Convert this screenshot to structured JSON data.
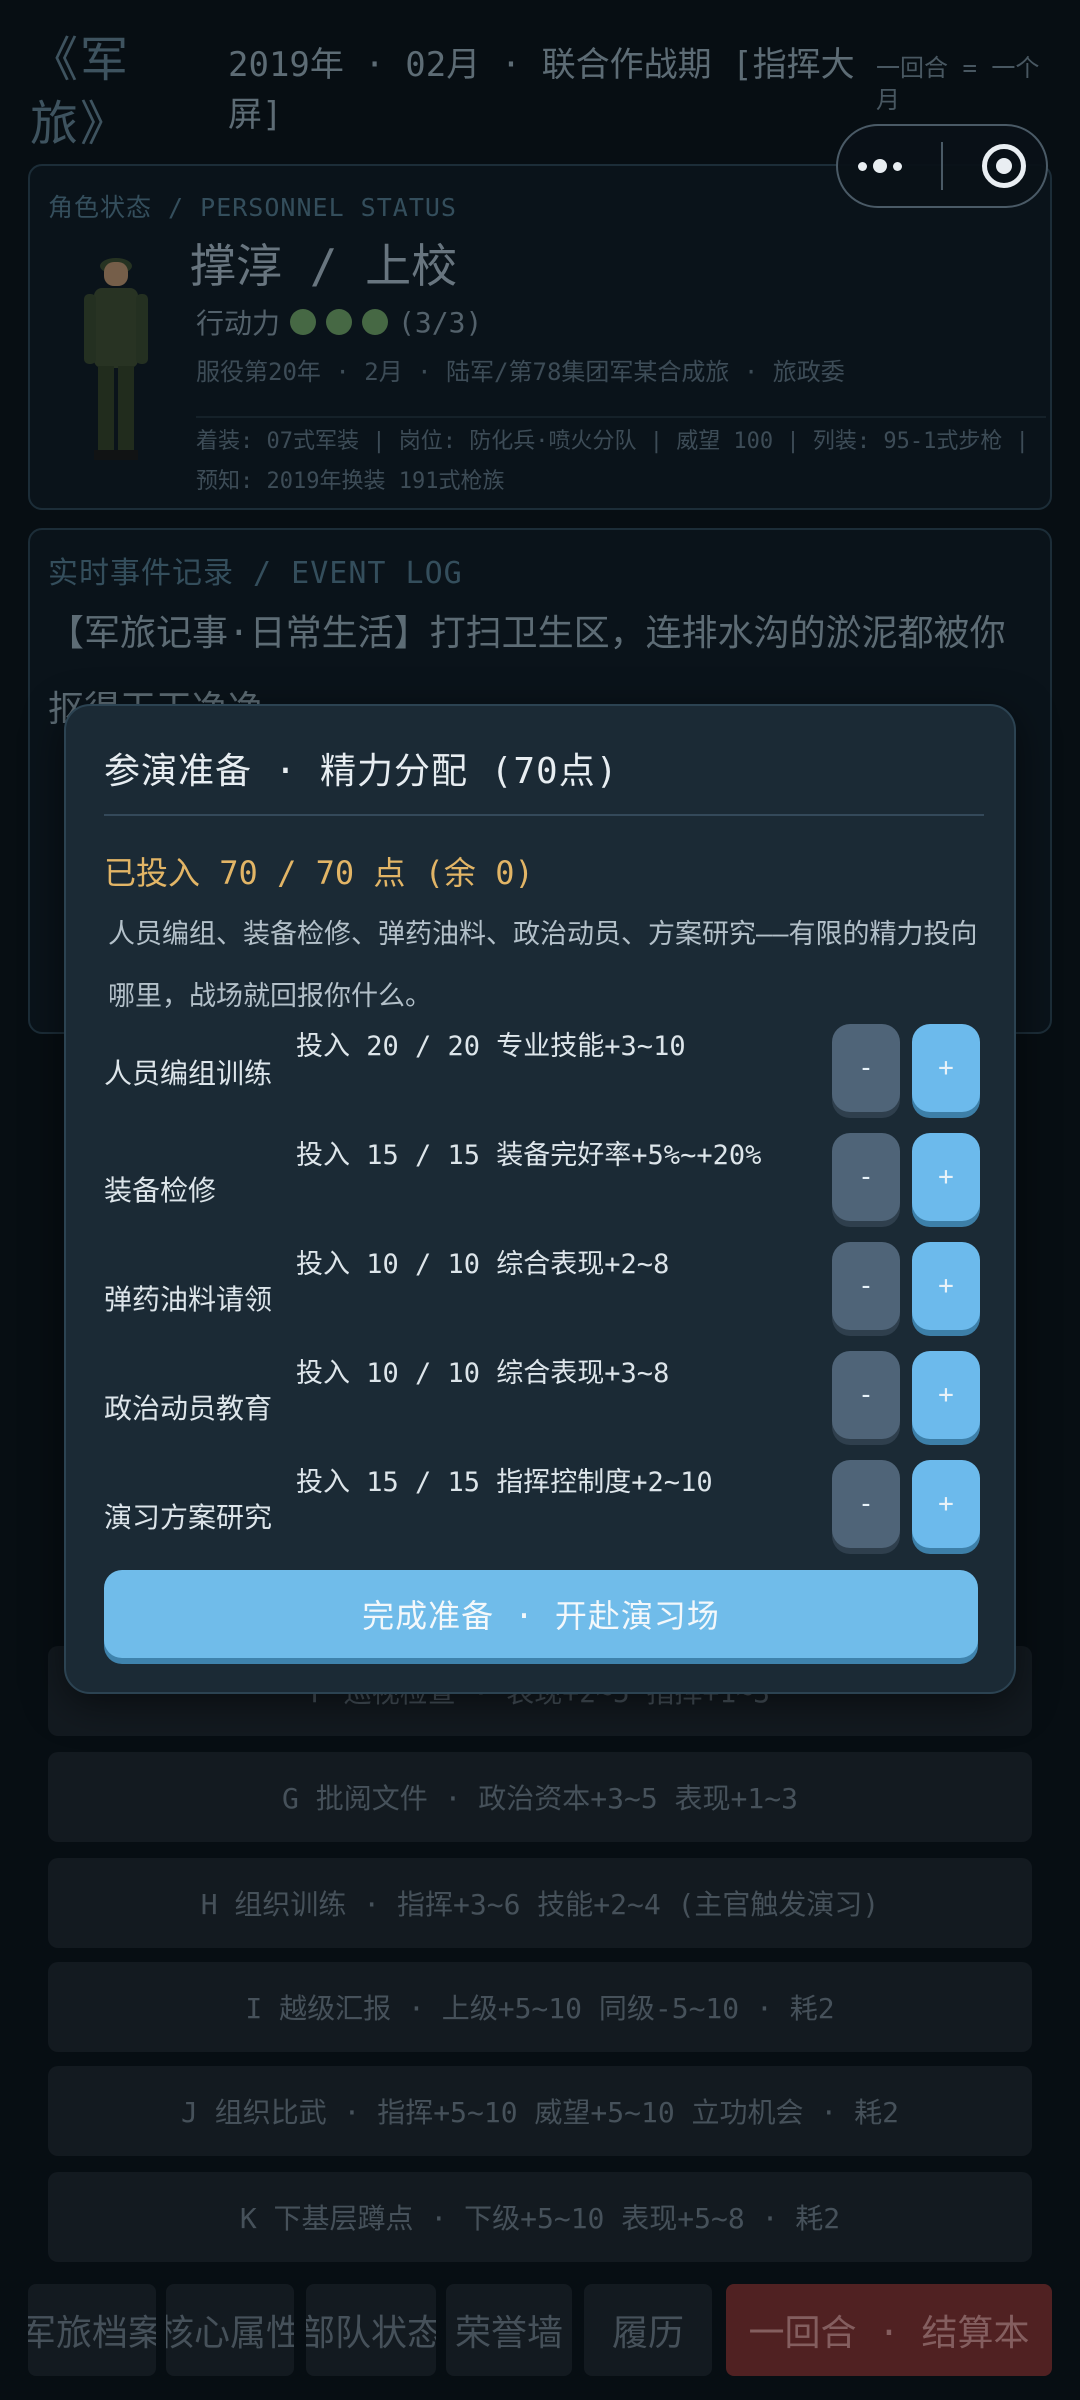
{
  "header": {
    "logo": "《军旅》",
    "date_line": "2019年 · 02月 · 联合作战期 [指挥大屏]",
    "turn_label": "一回合 = 一个月"
  },
  "status": {
    "caption": "角色状态 / PERSONNEL STATUS",
    "name": "撑淳  /  上校",
    "action_label": "行动力",
    "action_value": "(3/3)",
    "action_points": 3,
    "service": "服役第20年 · 2月 · 陆军/第78集团军某合成旅 · 旅政委",
    "info": "着装: 07式军装 | 岗位: 防化兵·喷火分队 | 威望 100 | 列装: 95-1式步枪 | 预知: 2019年换装 191式枪族"
  },
  "event": {
    "caption": "实时事件记录 / EVENT LOG",
    "text": "【军旅记事·日常生活】打扫卫生区，连排水沟的淤泥都被你抠得干干净净"
  },
  "actions": [
    "F 巡视检查 · 表现+2~5 指挥+1~3",
    "G 批阅文件 · 政治资本+3~5 表现+1~3",
    "H 组织训练 · 指挥+3~6 技能+2~4 (主官触发演习)",
    "I 越级汇报 · 上级+5~10 同级-5~10 · 耗2",
    "J 组织比武 · 指挥+5~10 威望+5~10 立功机会 · 耗2",
    "K 下基层蹲点 · 下级+5~10 表现+5~8 · 耗2"
  ],
  "nav": {
    "archive": "军旅档案",
    "attributes": "核心属性",
    "unit": "部队状态",
    "honor": "荣誉墙",
    "history": "履历",
    "end_turn": "一回合 · 结算本"
  },
  "dialog": {
    "title": "参演准备 · 精力分配 (70点)",
    "invested": "已投入 70 / 70 点 (余 0)",
    "intro": "人员编组、装备检修、弹药油料、政治动员、方案研究——有限的精力投向哪里，战场就回报你什么。",
    "minus_label": "-",
    "plus_label": "+",
    "rows": [
      {
        "name": "人员编组训练",
        "detail": "投入 20 / 20  专业技能+3~10"
      },
      {
        "name": "装备检修",
        "detail": "投入 15 / 15  装备完好率+5%~+20%"
      },
      {
        "name": "弹药油料请领",
        "detail": "投入 10 / 10  综合表现+2~8"
      },
      {
        "name": "政治动员教育",
        "detail": "投入 10 / 10  综合表现+3~8"
      },
      {
        "name": "演习方案研究",
        "detail": "投入 15 / 15  指挥控制度+2~10"
      }
    ],
    "confirm": "完成准备 · 开赴演习场"
  }
}
